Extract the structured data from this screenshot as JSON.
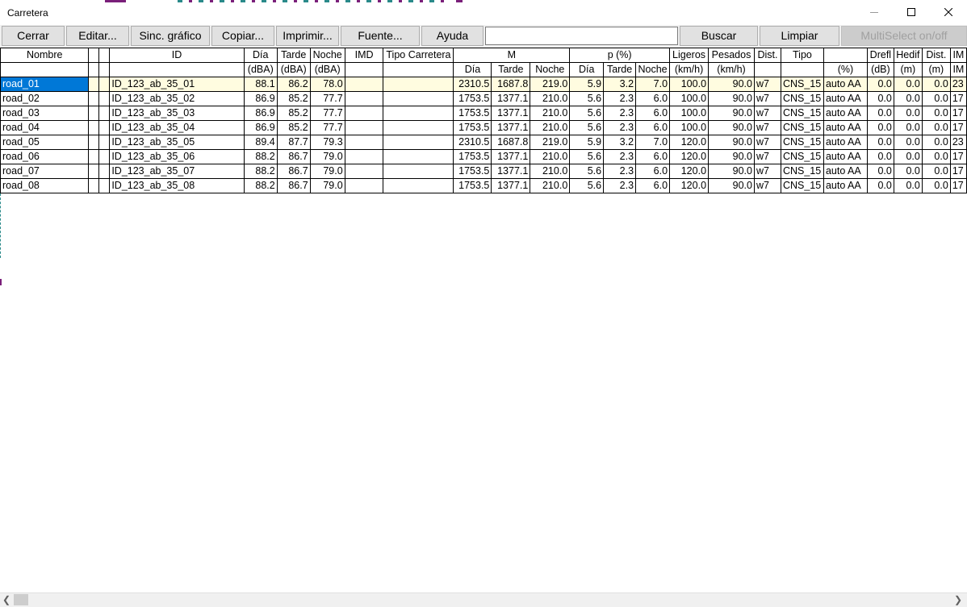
{
  "window": {
    "title": "Carretera",
    "controls": {
      "minimize": "minimize-icon",
      "maximize": "maximize-icon",
      "close": "close-icon"
    }
  },
  "toolbar": {
    "close_label": "Cerrar",
    "edit_label": "Editar...",
    "sync_label": "Sinc. gráfico",
    "copy_label": "Copiar...",
    "print_label": "Imprimir...",
    "font_label": "Fuente...",
    "help_label": "Ayuda",
    "search_value": "",
    "search_button": "Buscar",
    "clear_button": "Limpiar",
    "multiselect_label": "MultiSelect on/off"
  },
  "table": {
    "header1": [
      "Nombre",
      "",
      "",
      "ID",
      "Día",
      "Tarde",
      "Noche",
      "IMD",
      "Tipo Carretera",
      "M",
      "p (%)",
      "Ligeros",
      "Pesados",
      "Dist.",
      "Tipo",
      "",
      "Drefl",
      "Hedif",
      "Dist.",
      "IM"
    ],
    "header2": [
      "",
      "",
      "",
      "",
      "(dBA)",
      "(dBA)",
      "(dBA)",
      "",
      "",
      "Día",
      "Tarde",
      "Noche",
      "Día",
      "Tarde",
      "Noche",
      "(km/h)",
      "(km/h)",
      "",
      "",
      "(%)",
      "(dB)",
      "(m)",
      "(m)",
      "IM"
    ],
    "rows": [
      [
        "road_01",
        "",
        "",
        "ID_123_ab_35_01",
        "88.1",
        "86.2",
        "78.0",
        "",
        "",
        "2310.5",
        "1687.8",
        "219.0",
        "5.9",
        "3.2",
        "7.0",
        "100.0",
        "90.0",
        "w7",
        "CNS_15",
        "auto AA",
        "0.0",
        "0.0",
        "0.0",
        "23"
      ],
      [
        "road_02",
        "",
        "",
        "ID_123_ab_35_02",
        "86.9",
        "85.2",
        "77.7",
        "",
        "",
        "1753.5",
        "1377.1",
        "210.0",
        "5.6",
        "2.3",
        "6.0",
        "100.0",
        "90.0",
        "w7",
        "CNS_15",
        "auto AA",
        "0.0",
        "0.0",
        "0.0",
        "17"
      ],
      [
        "road_03",
        "",
        "",
        "ID_123_ab_35_03",
        "86.9",
        "85.2",
        "77.7",
        "",
        "",
        "1753.5",
        "1377.1",
        "210.0",
        "5.6",
        "2.3",
        "6.0",
        "100.0",
        "90.0",
        "w7",
        "CNS_15",
        "auto AA",
        "0.0",
        "0.0",
        "0.0",
        "17"
      ],
      [
        "road_04",
        "",
        "",
        "ID_123_ab_35_04",
        "86.9",
        "85.2",
        "77.7",
        "",
        "",
        "1753.5",
        "1377.1",
        "210.0",
        "5.6",
        "2.3",
        "6.0",
        "100.0",
        "90.0",
        "w7",
        "CNS_15",
        "auto AA",
        "0.0",
        "0.0",
        "0.0",
        "17"
      ],
      [
        "road_05",
        "",
        "",
        "ID_123_ab_35_05",
        "89.4",
        "87.7",
        "79.3",
        "",
        "",
        "2310.5",
        "1687.8",
        "219.0",
        "5.9",
        "3.2",
        "7.0",
        "120.0",
        "90.0",
        "w7",
        "CNS_15",
        "auto AA",
        "0.0",
        "0.0",
        "0.0",
        "23"
      ],
      [
        "road_06",
        "",
        "",
        "ID_123_ab_35_06",
        "88.2",
        "86.7",
        "79.0",
        "",
        "",
        "1753.5",
        "1377.1",
        "210.0",
        "5.6",
        "2.3",
        "6.0",
        "120.0",
        "90.0",
        "w7",
        "CNS_15",
        "auto AA",
        "0.0",
        "0.0",
        "0.0",
        "17"
      ],
      [
        "road_07",
        "",
        "",
        "ID_123_ab_35_07",
        "88.2",
        "86.7",
        "79.0",
        "",
        "",
        "1753.5",
        "1377.1",
        "210.0",
        "5.6",
        "2.3",
        "6.0",
        "120.0",
        "90.0",
        "w7",
        "CNS_15",
        "auto AA",
        "0.0",
        "0.0",
        "0.0",
        "17"
      ],
      [
        "road_08",
        "",
        "",
        "ID_123_ab_35_08",
        "88.2",
        "86.7",
        "79.0",
        "",
        "",
        "1753.5",
        "1377.1",
        "210.0",
        "5.6",
        "2.3",
        "6.0",
        "120.0",
        "90.0",
        "w7",
        "CNS_15",
        "auto AA",
        "0.0",
        "0.0",
        "0.0",
        "17"
      ]
    ]
  },
  "colors": {
    "selection": "#0078d7",
    "first_row_highlight": "#fffce0",
    "toolbar_bg": "#f0f0f0"
  },
  "scrollbar": {
    "left_icon": "chevron-left-icon",
    "right_icon": "chevron-right-icon"
  }
}
